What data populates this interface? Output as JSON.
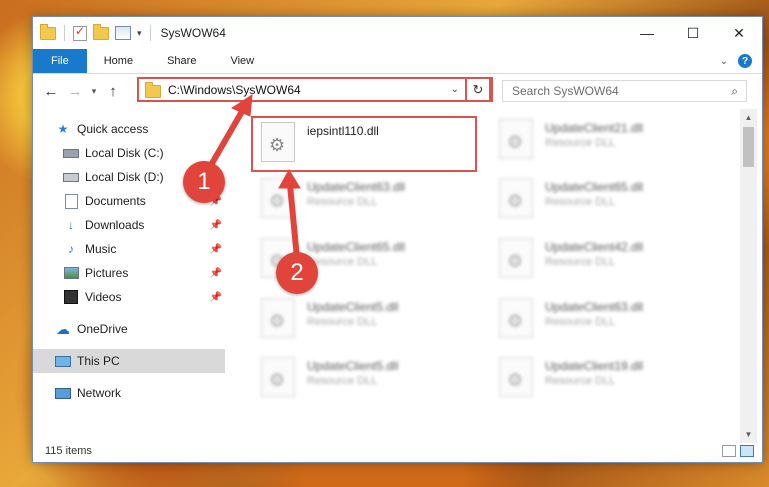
{
  "window": {
    "title": "SysWOW64",
    "controls": {
      "minimize": "—",
      "maximize": "☐",
      "close": "✕"
    }
  },
  "ribbon": {
    "tabs": [
      {
        "label": "File"
      },
      {
        "label": "Home"
      },
      {
        "label": "Share"
      },
      {
        "label": "View"
      }
    ],
    "help": "?"
  },
  "nav": {
    "back": "←",
    "forward": "→",
    "recent": "▾",
    "up": "↑",
    "address": "C:\\Windows\\SysWOW64",
    "address_dropdown": "⌄",
    "refresh": "↻",
    "search_placeholder": "Search SysWOW64",
    "search_icon": "⌕"
  },
  "sidebar": {
    "quick_access": "Quick access",
    "items": [
      {
        "label": "Local Disk (C:)",
        "icon": "drive-icon"
      },
      {
        "label": "Local Disk (D:)",
        "icon": "drive-icon"
      },
      {
        "label": "Documents",
        "icon": "documents-icon"
      },
      {
        "label": "Downloads",
        "icon": "download-icon"
      },
      {
        "label": "Music",
        "icon": "music-icon"
      },
      {
        "label": "Pictures",
        "icon": "pictures-icon"
      },
      {
        "label": "Videos",
        "icon": "videos-icon"
      }
    ],
    "onedrive": "OneDrive",
    "this_pc": "This PC",
    "network": "Network"
  },
  "files": {
    "highlighted": {
      "name": "iepsintl110.dll",
      "type": ""
    },
    "blurred": [
      {
        "name": "UpdateClient21.dll",
        "type": "Resource DLL"
      },
      {
        "name": "UpdateClient63.dll",
        "type": "Resource DLL"
      },
      {
        "name": "UpdateClient65.dll",
        "type": "Resource DLL"
      },
      {
        "name": "UpdateClient65.dll",
        "type": "Resource DLL"
      },
      {
        "name": "UpdateClient42.dll",
        "type": "Resource DLL"
      },
      {
        "name": "UpdateClient5.dll",
        "type": "Resource DLL"
      },
      {
        "name": "UpdateClient63.dll",
        "type": "Resource DLL"
      },
      {
        "name": "UpdateClient5.dll",
        "type": "Resource DLL"
      },
      {
        "name": "UpdateClient19.dll",
        "type": "Resource DLL"
      }
    ]
  },
  "status": {
    "count": "115 items"
  },
  "annotations": {
    "step1": "1",
    "step2": "2"
  },
  "colors": {
    "accent": "#1979ca",
    "highlight": "#d9534f",
    "badge": "#e1443a"
  }
}
